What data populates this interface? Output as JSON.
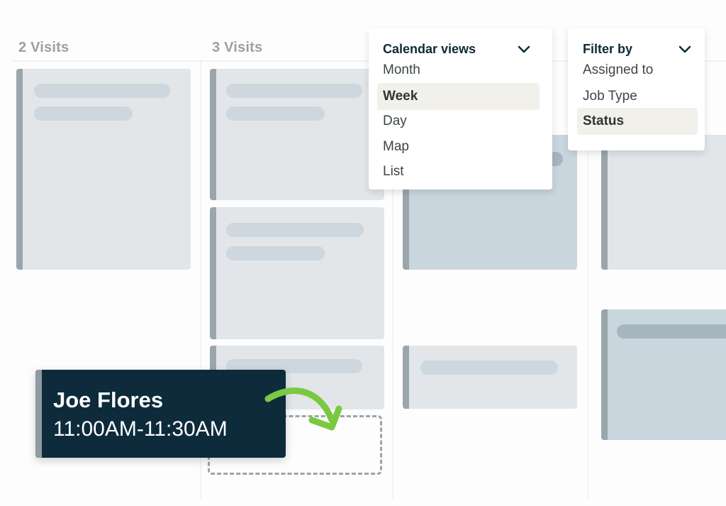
{
  "calendar": {
    "columns": [
      {
        "visits_label": "2 Visits"
      },
      {
        "visits_label": "3 Visits"
      }
    ]
  },
  "calendar_views": {
    "title": "Calendar views",
    "items": [
      {
        "label": "Month",
        "selected": false
      },
      {
        "label": "Week",
        "selected": true
      },
      {
        "label": "Day",
        "selected": false
      },
      {
        "label": "Map",
        "selected": false
      },
      {
        "label": "List",
        "selected": false
      }
    ]
  },
  "filter_by": {
    "title": "Filter by",
    "items": [
      {
        "label": "Assigned to",
        "selected": false
      },
      {
        "label": "Job Type",
        "selected": false
      },
      {
        "label": "Status",
        "selected": true
      }
    ]
  },
  "dragged_event": {
    "name": "Joe Flores",
    "time": "11:00AM-11:30AM"
  },
  "colors": {
    "event_bg": "#0d2b3b",
    "arrow": "#7ac943",
    "selected_item_bg": "#f1f0ea"
  }
}
